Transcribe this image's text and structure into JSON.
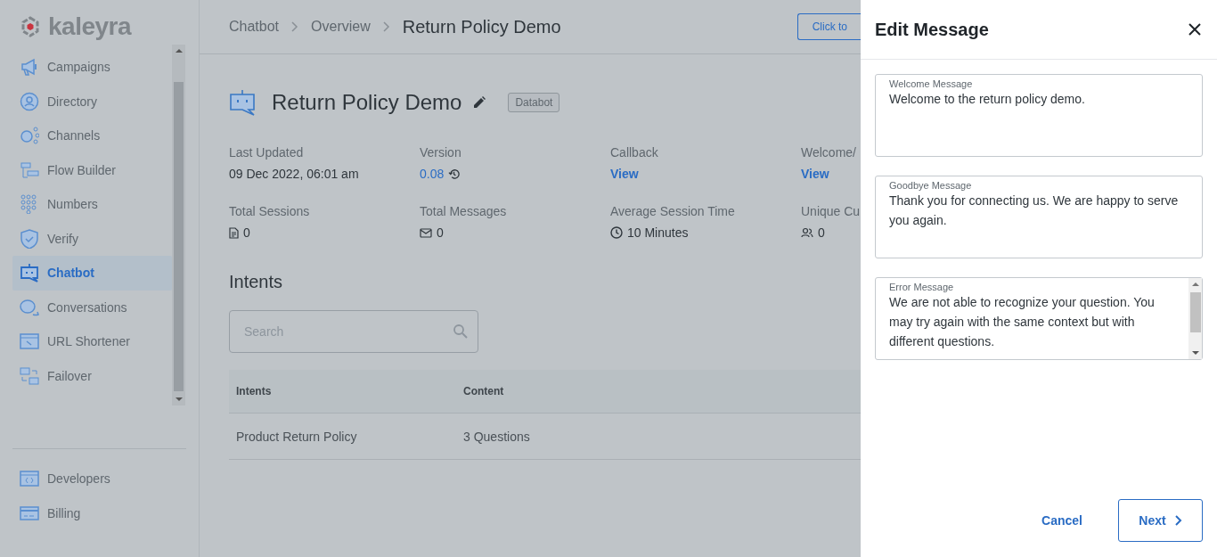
{
  "logo": {
    "text": "kaleyra"
  },
  "sidebar": {
    "items": [
      {
        "label": "Campaigns",
        "selected": false
      },
      {
        "label": "Directory",
        "selected": false
      },
      {
        "label": "Channels",
        "selected": false
      },
      {
        "label": "Flow Builder",
        "selected": false
      },
      {
        "label": "Numbers",
        "selected": false
      },
      {
        "label": "Verify",
        "selected": false
      },
      {
        "label": "Chatbot",
        "selected": true
      },
      {
        "label": "Conversations",
        "selected": false
      },
      {
        "label": "URL Shortener",
        "selected": false
      },
      {
        "label": "Failover",
        "selected": false
      }
    ],
    "bottom_items": [
      {
        "label": "Developers",
        "selected": false
      },
      {
        "label": "Billing",
        "selected": false
      }
    ]
  },
  "breadcrumb": [
    "Chatbot",
    "Overview",
    "Return Policy Demo"
  ],
  "header_button": "Click to",
  "bot": {
    "title": "Return Policy Demo",
    "tag": "Databot"
  },
  "stats": [
    {
      "label": "Last Updated",
      "value": "09 Dec 2022, 06:01 am",
      "kind": "text"
    },
    {
      "label": "Version",
      "value": "0.08",
      "kind": "version"
    },
    {
      "label": "Callback",
      "value": "View",
      "kind": "link"
    },
    {
      "label": "Welcome/",
      "value": "View",
      "kind": "link"
    },
    {
      "label": "Total Sessions",
      "value": "0",
      "kind": "document"
    },
    {
      "label": "Total Messages",
      "value": "0",
      "kind": "mail"
    },
    {
      "label": "Average Session Time",
      "value": "10 Minutes",
      "kind": "clock"
    },
    {
      "label": "Unique Cu",
      "value": "0",
      "kind": "users"
    }
  ],
  "intents": {
    "title": "Intents",
    "search": {
      "placeholder": "Search"
    },
    "columns": [
      "Intents",
      "Content"
    ],
    "rows": [
      [
        "Product Return Policy",
        "3 Questions"
      ]
    ]
  },
  "drawer": {
    "title": "Edit Message",
    "fields": [
      {
        "label": "Welcome Message",
        "value": "Welcome to the return policy demo.",
        "scrollable": false
      },
      {
        "label": "Goodbye Message",
        "value": "Thank you for connecting us. We are happy to serve you again.",
        "scrollable": false
      },
      {
        "label": "Error Message",
        "value": "We are not able to recognize your question. You may try again with the same context but with different questions.",
        "scrollable": true
      }
    ],
    "cancel": "Cancel",
    "next": "Next"
  }
}
